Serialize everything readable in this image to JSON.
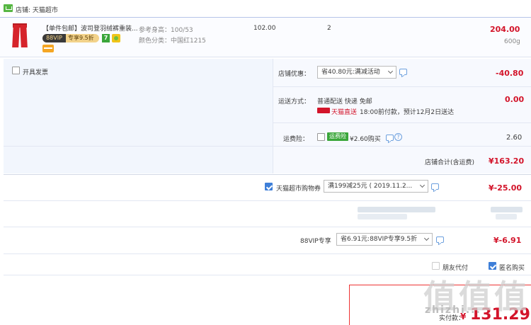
{
  "shop": {
    "label": "店铺: 天猫超市"
  },
  "item": {
    "title": "【单件包邮】波司登羽绒裤重装...",
    "vip_tag": "88VIP",
    "vip_discount": "专享9.5折",
    "seven_badge": "7",
    "spec_size": "参考身高：100/53",
    "spec_color": "颜色分类：中国红1215",
    "unit_price": "102.00",
    "quantity": "2",
    "subtotal": "204.00",
    "weight": "600g"
  },
  "invoice": {
    "label": "开具发票"
  },
  "shop_discount": {
    "label": "店铺优惠：",
    "selected": "省40.80元:满减活动",
    "amount": "-40.80"
  },
  "delivery": {
    "label": "运送方式：",
    "method": "普通配送 快递 免邮",
    "brand": "天猫直送",
    "eta": "18:00前付款，预计12月2日送达",
    "amount": "0.00"
  },
  "freight_insurance": {
    "label": "运费险：",
    "tag": "运费险",
    "price": "¥2.60购买",
    "amount": "2.60",
    "help": "?"
  },
  "shop_total": {
    "label": "店铺合计(含运费)",
    "amount": "¥163.20"
  },
  "coupon": {
    "label": "天猫超市购物券",
    "selected": "满199减25元 ( 2019.11.2...",
    "amount": "¥-25.00"
  },
  "vip88": {
    "label": "88VIP专享",
    "selected": "省6.91元:88VIP专享9.5折",
    "amount": "¥-6.91"
  },
  "options": {
    "friend_pay": "朋友代付",
    "anonymous": "匿名购买"
  },
  "payment": {
    "label": "实付款：",
    "amount": "131.29"
  },
  "watermark": {
    "main": "值值值",
    "sub": "zhizhi..."
  },
  "colors": {
    "price_red": "#d3142a",
    "accent_blue": "#3e7fd8",
    "panel_bg": "#f2f6fd"
  }
}
